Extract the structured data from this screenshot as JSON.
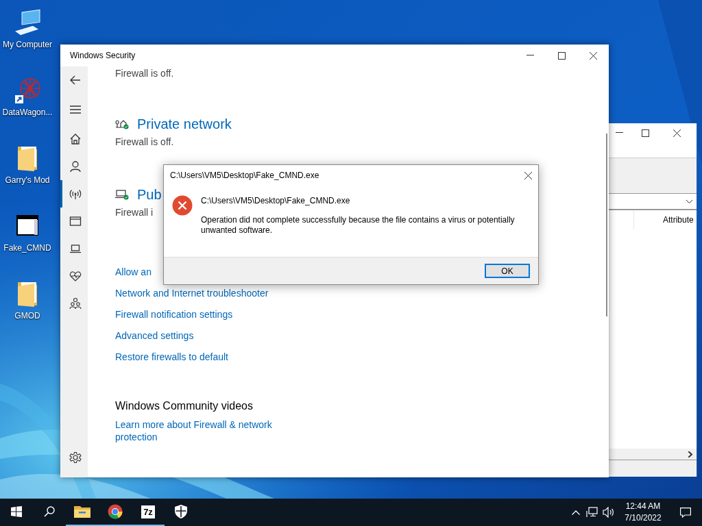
{
  "desktop": {
    "icons": [
      {
        "label": "My Computer",
        "kind": "computer"
      },
      {
        "label": "DataWagon...",
        "kind": "shortcut"
      },
      {
        "label": "Garry's Mod",
        "kind": "folder"
      },
      {
        "label": "Fake_CMND",
        "kind": "window"
      },
      {
        "label": "GMOD",
        "kind": "folder"
      }
    ]
  },
  "background_window": {
    "column_header": "Attribute"
  },
  "security_window": {
    "title": "Windows Security",
    "nav": [
      {
        "kind": "back",
        "selected": false
      },
      {
        "kind": "menu",
        "selected": false
      },
      {
        "kind": "home",
        "selected": false
      },
      {
        "kind": "account",
        "selected": false
      },
      {
        "kind": "network",
        "selected": true
      },
      {
        "kind": "app",
        "selected": false
      },
      {
        "kind": "device",
        "selected": false
      },
      {
        "kind": "health",
        "selected": false
      },
      {
        "kind": "family",
        "selected": false
      },
      {
        "kind": "settings",
        "selected": false
      }
    ],
    "top_status": "Firewall is off.",
    "networks": [
      {
        "kind": "private",
        "name": "Private network",
        "status": "Firewall is off."
      },
      {
        "kind": "public",
        "name": "Pub",
        "status": "Firewall i"
      }
    ],
    "links": [
      "Allow an",
      "Network and Internet troubleshooter",
      "Firewall notification settings",
      "Advanced settings",
      "Restore firewalls to default"
    ],
    "community": {
      "heading": "Windows Community videos",
      "link": "Learn more about Firewall & network protection"
    }
  },
  "dialog": {
    "title": "C:\\Users\\VM5\\Desktop\\Fake_CMND.exe",
    "path": "C:\\Users\\VM5\\Desktop\\Fake_CMND.exe",
    "message": "Operation did not complete successfully because the file contains a virus or potentially unwanted software.",
    "button": "OK"
  },
  "taskbar": {
    "buttons": [
      {
        "kind": "start"
      },
      {
        "kind": "search"
      }
    ],
    "apps": [
      {
        "kind": "folder",
        "running": true
      },
      {
        "kind": "browser",
        "running": true
      },
      {
        "kind": "archiver",
        "label": "7z",
        "running": true
      },
      {
        "kind": "shield",
        "running": false
      }
    ],
    "time": "12:44 AM",
    "date": "7/10/2022"
  }
}
